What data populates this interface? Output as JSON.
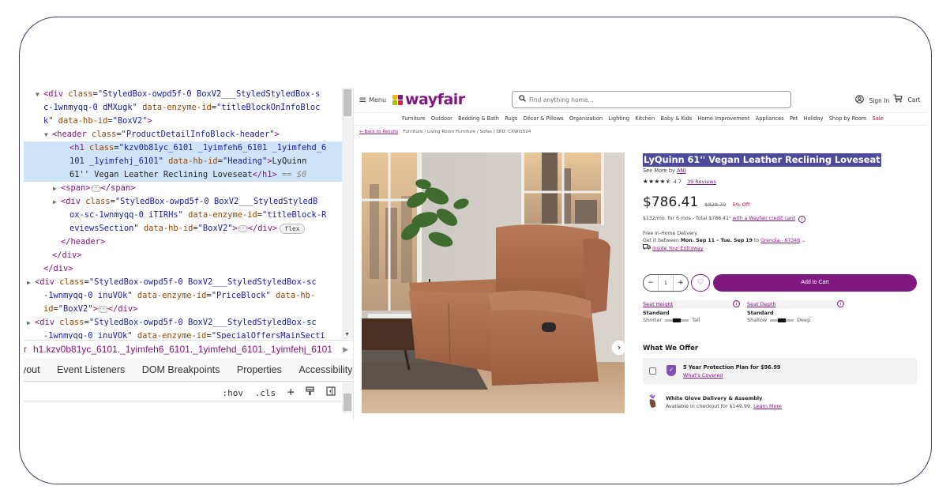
{
  "devtools": {
    "dom_lines": [
      {
        "indent": 1,
        "tri": "▼",
        "parts": [
          [
            "tg",
            "<div "
          ],
          [
            "at",
            "class"
          ],
          [
            "tx",
            "="
          ],
          [
            "av",
            "\"StyledBox-owpd5f-0 BoxV2___StyledStyledBox-s"
          ]
        ]
      },
      {
        "indent": 1,
        "tri": "",
        "parts": [
          [
            "av",
            "c-1wnmyqq-0 dMXugk\" "
          ],
          [
            "at",
            "data-enzyme-id"
          ],
          [
            "tx",
            "="
          ],
          [
            "av",
            "\"titleBlockOnInfoBloc"
          ]
        ]
      },
      {
        "indent": 1,
        "tri": "",
        "parts": [
          [
            "av",
            "k\" "
          ],
          [
            "at",
            "data-hb-id"
          ],
          [
            "tx",
            "="
          ],
          [
            "av",
            "\"BoxV2\""
          ],
          [
            "tg",
            ">"
          ]
        ]
      },
      {
        "indent": 2,
        "tri": "▼",
        "parts": [
          [
            "tg",
            "<header "
          ],
          [
            "at",
            "class"
          ],
          [
            "tx",
            "="
          ],
          [
            "av",
            "\"ProductDetailInfoBlock-header\""
          ],
          [
            "tg",
            ">"
          ]
        ]
      },
      {
        "indent": 4,
        "tri": "",
        "sel": true,
        "parts": [
          [
            "tg",
            "<h1 "
          ],
          [
            "at",
            "class"
          ],
          [
            "tx",
            "="
          ],
          [
            "av",
            "\"kzv0b81yc_6101 _1yimfeh6_6101 _1yimfehd_6"
          ]
        ]
      },
      {
        "indent": 4,
        "tri": "",
        "sel": true,
        "parts": [
          [
            "av",
            "101 _1yimfehj_6101\" "
          ],
          [
            "at",
            "data-hb-id"
          ],
          [
            "tx",
            "="
          ],
          [
            "av",
            "\"Heading\""
          ],
          [
            "tg",
            ">"
          ],
          [
            "tx",
            "LyQuinn"
          ]
        ]
      },
      {
        "indent": 4,
        "tri": "",
        "sel": true,
        "parts": [
          [
            "tx",
            "61'' Vegan Leather Reclining Loveseat"
          ],
          [
            "tg",
            "</h1>"
          ],
          [
            "eq",
            " == $0"
          ]
        ]
      },
      {
        "indent": 3,
        "tri": "▶",
        "parts": [
          [
            "tg",
            "<span>"
          ],
          [
            "ell",
            ""
          ],
          [
            "tg",
            "</span>"
          ]
        ]
      },
      {
        "indent": 3,
        "tri": "▶",
        "parts": [
          [
            "tg",
            "<div "
          ],
          [
            "at",
            "class"
          ],
          [
            "tx",
            "="
          ],
          [
            "av",
            "\"StyledBox-owpd5f-0 BoxV2___StyledStyledB"
          ]
        ]
      },
      {
        "indent": 4,
        "tri": "",
        "parts": [
          [
            "av",
            "ox-sc-1wnmyqq-0 iTIRHs\" "
          ],
          [
            "at",
            "data-enzyme-id"
          ],
          [
            "tx",
            "="
          ],
          [
            "av",
            "\"titleBlock-R"
          ]
        ]
      },
      {
        "indent": 4,
        "tri": "",
        "parts": [
          [
            "av",
            "eviewsSection\" "
          ],
          [
            "at",
            "data-hb-id"
          ],
          [
            "tx",
            "="
          ],
          [
            "av",
            "\"BoxV2\""
          ],
          [
            "tg",
            ">"
          ],
          [
            "ell",
            ""
          ],
          [
            "tg",
            "</div>"
          ],
          [
            "badge",
            "flex"
          ]
        ]
      },
      {
        "indent": 3,
        "tri": "",
        "parts": [
          [
            "tg",
            "</header>"
          ]
        ]
      },
      {
        "indent": 2,
        "tri": "",
        "parts": [
          [
            "tg",
            "</div>"
          ]
        ]
      },
      {
        "indent": 1,
        "tri": "",
        "parts": [
          [
            "tg",
            "</div>"
          ]
        ]
      },
      {
        "indent": 0,
        "tri": "▶",
        "parts": [
          [
            "tg",
            "<div "
          ],
          [
            "at",
            "class"
          ],
          [
            "tx",
            "="
          ],
          [
            "av",
            "\"StyledBox-owpd5f-0 BoxV2___StyledStyledBox-sc"
          ]
        ]
      },
      {
        "indent": 1,
        "tri": "",
        "parts": [
          [
            "av",
            "-1wnmyqq-0 inuVOk\" "
          ],
          [
            "at",
            "data-enzyme-id"
          ],
          [
            "tx",
            "="
          ],
          [
            "av",
            "\"PriceBlock\" "
          ],
          [
            "at",
            "data-hb-"
          ]
        ]
      },
      {
        "indent": 1,
        "tri": "",
        "parts": [
          [
            "at",
            "id"
          ],
          [
            "tx",
            "="
          ],
          [
            "av",
            "\"BoxV2\""
          ],
          [
            "tg",
            ">"
          ],
          [
            "ell",
            ""
          ],
          [
            "tg",
            "</div>"
          ]
        ]
      },
      {
        "indent": 0,
        "tri": "▶",
        "parts": [
          [
            "tg",
            "<div "
          ],
          [
            "at",
            "class"
          ],
          [
            "tx",
            "="
          ],
          [
            "av",
            "\"StyledBox-owpd5f-0 BoxV2___StyledStyledBox-sc"
          ]
        ]
      },
      {
        "indent": 1,
        "tri": "",
        "parts": [
          [
            "av",
            "-1wnmyqq-0 inuVOk\" "
          ],
          [
            "at",
            "data-enzyme-id"
          ],
          [
            "tx",
            "="
          ],
          [
            "av",
            "\"SpecialOffersMainSecti"
          ]
        ]
      }
    ],
    "breadcrumb_prefix": "r",
    "breadcrumb_current": "h1.kzv0b81yc_6101._1yimfeh6_6101._1yimfehd_6101._1yimfehj_6101",
    "tabs": [
      "ayout",
      "Event Listeners",
      "DOM Breakpoints",
      "Properties",
      "Accessibility"
    ],
    "filter_placeholder": "",
    "filter_tools": {
      "hov": ":hov",
      "cls": ".cls",
      "add": "+",
      "paint": "🖌",
      "sidebar": "◧"
    }
  },
  "wayfair": {
    "menu_label": "Menu",
    "logo_text": "wayfair",
    "search_placeholder": "Find anything home...",
    "sign_in": "Sign In",
    "cart": "Cart",
    "categories": [
      "Furniture",
      "Outdoor",
      "Bedding & Bath",
      "Rugs",
      "Décor & Pillows",
      "Organization",
      "Lighting",
      "Kitchen",
      "Baby & Kids",
      "Home Improvement",
      "Appliances",
      "Pet",
      "Holiday",
      "Shop by Room"
    ],
    "sale_label": "Sale",
    "back_to_results": "Back to Results",
    "breadcrumb": "Furniture  /  Living Room Furniture  /  Sofas  /  SKU: CXWI1524",
    "product": {
      "title": "LyQuinn 61'' Vegan Leather Reclining Loveseat",
      "see_more_prefix": "See More by ",
      "brand": "ANJ",
      "stars": "★★★★⯪",
      "rating": "4.7",
      "reviews": "39 Reviews",
      "price": "$786.41",
      "was_price": "$828.70",
      "discount": "5% Off",
      "financing_text": "$132/mo. for 6 mos - Total $786.41¹ ",
      "financing_link": "with a Wayfair credit card",
      "delivery_title": "Free In-Home Delivery",
      "delivery_prefix": "Get it between ",
      "delivery_dates": "Mon. Sep 11 – Tue. Sep 19",
      "delivery_to": " to ",
      "delivery_location": "Grenola - 67346",
      "delivery_option": "Inside Your Entryway",
      "quantity": "1",
      "qty_minus": "−",
      "qty_plus": "+",
      "add_to_cart": "Add to Cart",
      "seat_height_label": "Seat Height",
      "seat_height_value": "Standard",
      "seat_height_low": "Shorter",
      "seat_height_high": "Tall",
      "seat_depth_label": "Seat Depth",
      "seat_depth_value": "Standard",
      "seat_depth_low": "Shallow",
      "seat_depth_high": "Deep",
      "offer_heading": "What We Offer",
      "protection_plan": "5 Year Protection Plan for $96.99",
      "whats_covered": "What's Covered",
      "white_glove_title": "White Glove Delivery & Assembly",
      "white_glove_sub": "Available in checkout for $149.99. ",
      "learn_more": "Learn More"
    }
  },
  "colors": {
    "brand": "#7f187f",
    "sale": "#cc0033",
    "selection": "#4d4a9b",
    "dom_selected": "#cfe3f9"
  }
}
